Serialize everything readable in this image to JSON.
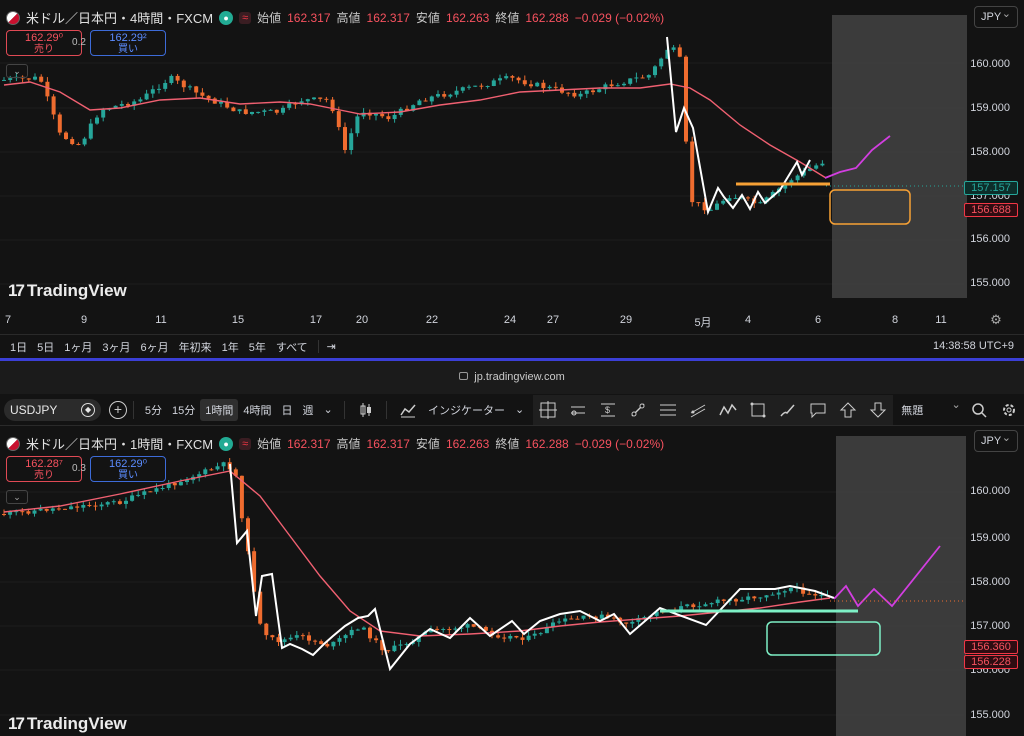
{
  "top_chart": {
    "legend": {
      "symbol": "米ドル／日本円・4時間・FXCM",
      "open_label": "始値",
      "open": "162.317",
      "high_label": "高値",
      "high": "162.317",
      "low_label": "安値",
      "low": "162.263",
      "close_label": "終値",
      "close": "162.288",
      "change": "−0.029 (−0.02%)"
    },
    "sell_price": "162.29⁰",
    "sell_label": "売り",
    "buy_price": "162.29²",
    "buy_label": "買い",
    "spread": "0.2",
    "currency": "JPY",
    "y_ticks": [
      "160.000",
      "159.000",
      "158.000",
      "157.000",
      "156.000",
      "155.000"
    ],
    "price_labels": {
      "green": "157.157",
      "red": "156.688"
    },
    "x_ticks": [
      "7",
      "9",
      "11",
      "15",
      "17",
      "20",
      "22",
      "24",
      "27",
      "29",
      "5月",
      "4",
      "6",
      "8",
      "11"
    ],
    "logo": "TradingView"
  },
  "range_bar": {
    "items": [
      "1日",
      "5日",
      "1ヶ月",
      "3ヶ月",
      "6ヶ月",
      "年初来",
      "1年",
      "5年",
      "すべて"
    ],
    "clock": "14:38:58 UTC+9"
  },
  "url": "jp.tradingview.com",
  "toolbar": {
    "symbol": "USDJPY",
    "intervals": [
      "5分",
      "15分",
      "1時間",
      "4時間",
      "日",
      "週"
    ],
    "active_interval": "1時間",
    "indicators": "インジケーター",
    "layout_name": "無題"
  },
  "bottom_chart": {
    "legend": {
      "symbol": "米ドル／日本円・1時間・FXCM",
      "open_label": "始値",
      "open": "162.317",
      "high_label": "高値",
      "high": "162.317",
      "low_label": "安値",
      "low": "162.263",
      "close_label": "終値",
      "close": "162.288",
      "change": "−0.029 (−0.02%)"
    },
    "sell_price": "162.28⁷",
    "sell_label": "売り",
    "buy_price": "162.29⁰",
    "buy_label": "買い",
    "spread": "0.3",
    "currency": "JPY",
    "y_ticks": [
      "160.000",
      "159.000",
      "158.000",
      "157.000",
      "156.000",
      "155.000"
    ],
    "price_labels": {
      "red1": "156.360",
      "red2": "156.228"
    },
    "logo": "TradingView"
  },
  "colors": {
    "up": "#26a69a",
    "down": "#ef6c2f",
    "ma": "#f06071",
    "zigzag": "#ffffff",
    "forecast": "#d23ee0",
    "orange_line": "#f7a135",
    "mint_line": "#7ef0c6",
    "price_green": "#26a69a",
    "price_red": "#f23645"
  },
  "icons": [
    "eye-icon",
    "wave-icon",
    "search-icon",
    "add-symbol-icon",
    "candle-type-icon",
    "indicators-icon",
    "crosshair-icon",
    "horizontal-ray-icon",
    "price-range-icon",
    "trendline-icon",
    "fib-icon",
    "channel-icon",
    "path-icon",
    "rectangle-icon",
    "brush-icon",
    "comment-icon",
    "arrow-up-icon",
    "arrow-down-icon",
    "magnify-icon",
    "settings-icon",
    "date-range-icon"
  ]
}
